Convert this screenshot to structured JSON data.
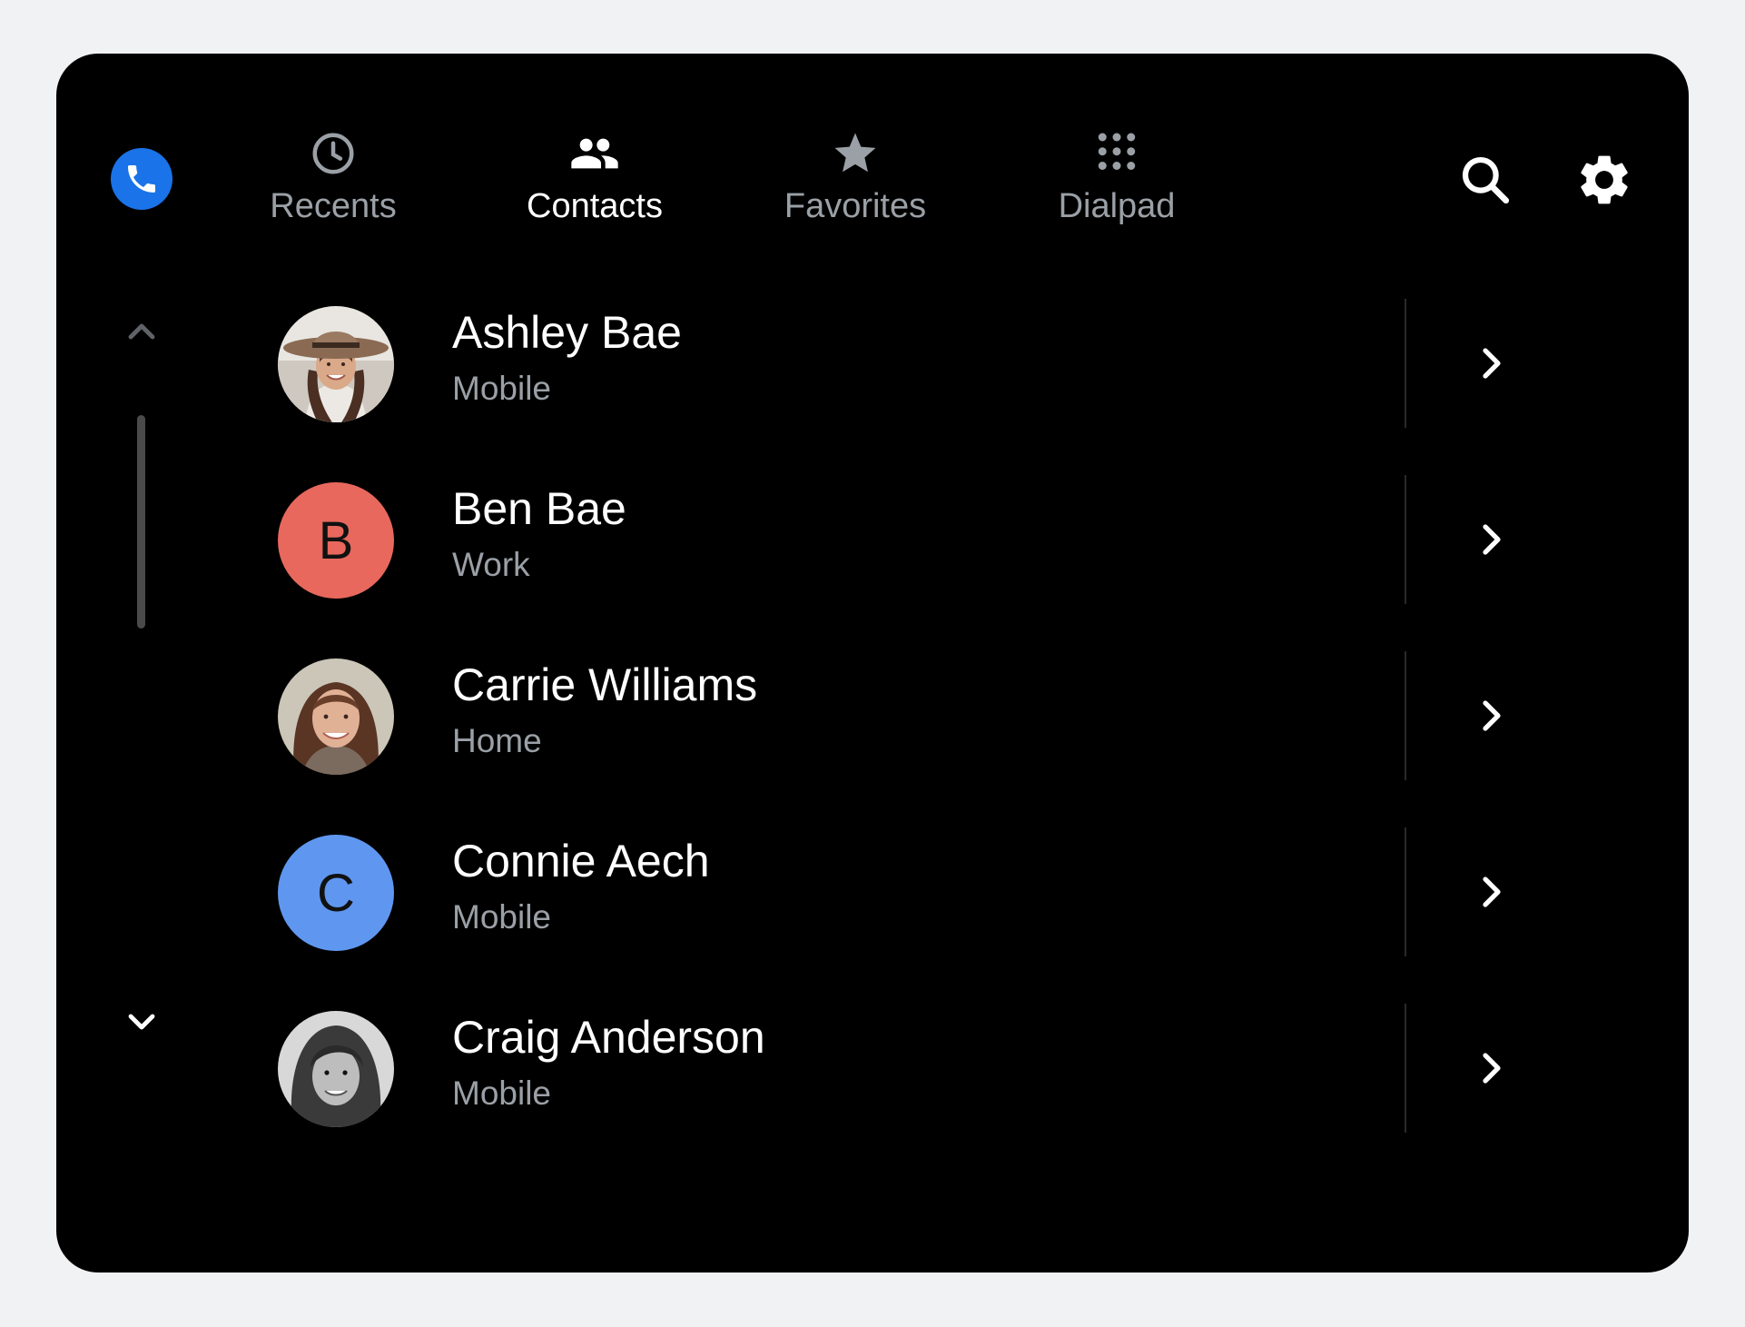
{
  "app": {
    "icon": "phone-icon",
    "accent": "#1a73e8"
  },
  "tabs": [
    {
      "label": "Recents",
      "icon": "clock-icon",
      "active": false
    },
    {
      "label": "Contacts",
      "icon": "people-icon",
      "active": true
    },
    {
      "label": "Favorites",
      "icon": "star-icon",
      "active": false
    },
    {
      "label": "Dialpad",
      "icon": "dialpad-icon",
      "active": false
    }
  ],
  "actions": {
    "search_icon": "search-icon",
    "settings_icon": "gear-icon"
  },
  "contacts": [
    {
      "name": "Ashley Bae",
      "type": "Mobile",
      "avatar": "photo"
    },
    {
      "name": "Ben Bae",
      "type": "Work",
      "avatar": "letter",
      "letter": "B",
      "color": "#e8685d"
    },
    {
      "name": "Carrie Williams",
      "type": "Home",
      "avatar": "photo"
    },
    {
      "name": "Connie Aech",
      "type": "Mobile",
      "avatar": "letter",
      "letter": "C",
      "color": "#5f97f0"
    },
    {
      "name": "Craig Anderson",
      "type": "Mobile",
      "avatar": "photo"
    }
  ]
}
